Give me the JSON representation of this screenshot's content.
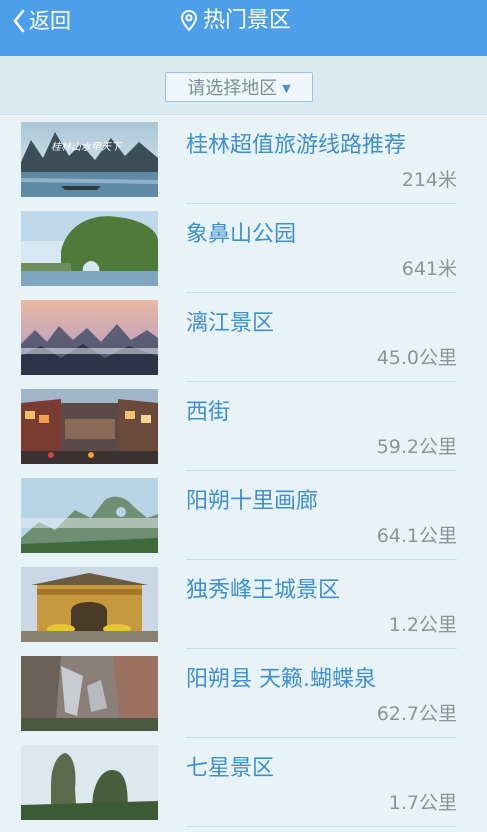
{
  "header": {
    "back_label": "返回",
    "back_icon": "chevron-left-icon",
    "title_icon": "map-pin-icon",
    "title": "热门景区",
    "background_color": "#4c9fe8"
  },
  "filter": {
    "region_select_value": "请选择地区",
    "arrow_icon": "dropdown-triangle-icon"
  },
  "attractions": [
    {
      "name": "桂林超值旅游线路推荐",
      "distance": "214米",
      "thumbnail_text": "桂林山水甲天下"
    },
    {
      "name": "象鼻山公园",
      "distance": "641米"
    },
    {
      "name": "漓江景区",
      "distance": "45.0公里"
    },
    {
      "name": "西街",
      "distance": "59.2公里"
    },
    {
      "name": "阳朔十里画廊",
      "distance": "64.1公里"
    },
    {
      "name": "独秀峰王城景区",
      "distance": "1.2公里"
    },
    {
      "name": "阳朔县 天籁.蝴蝶泉",
      "distance": "62.7公里"
    },
    {
      "name": "七星景区",
      "distance": "1.7公里"
    }
  ],
  "colors": {
    "accent": "#4c9fe8",
    "name_text": "#3f8fd1",
    "distance_text": "#8a949b"
  }
}
